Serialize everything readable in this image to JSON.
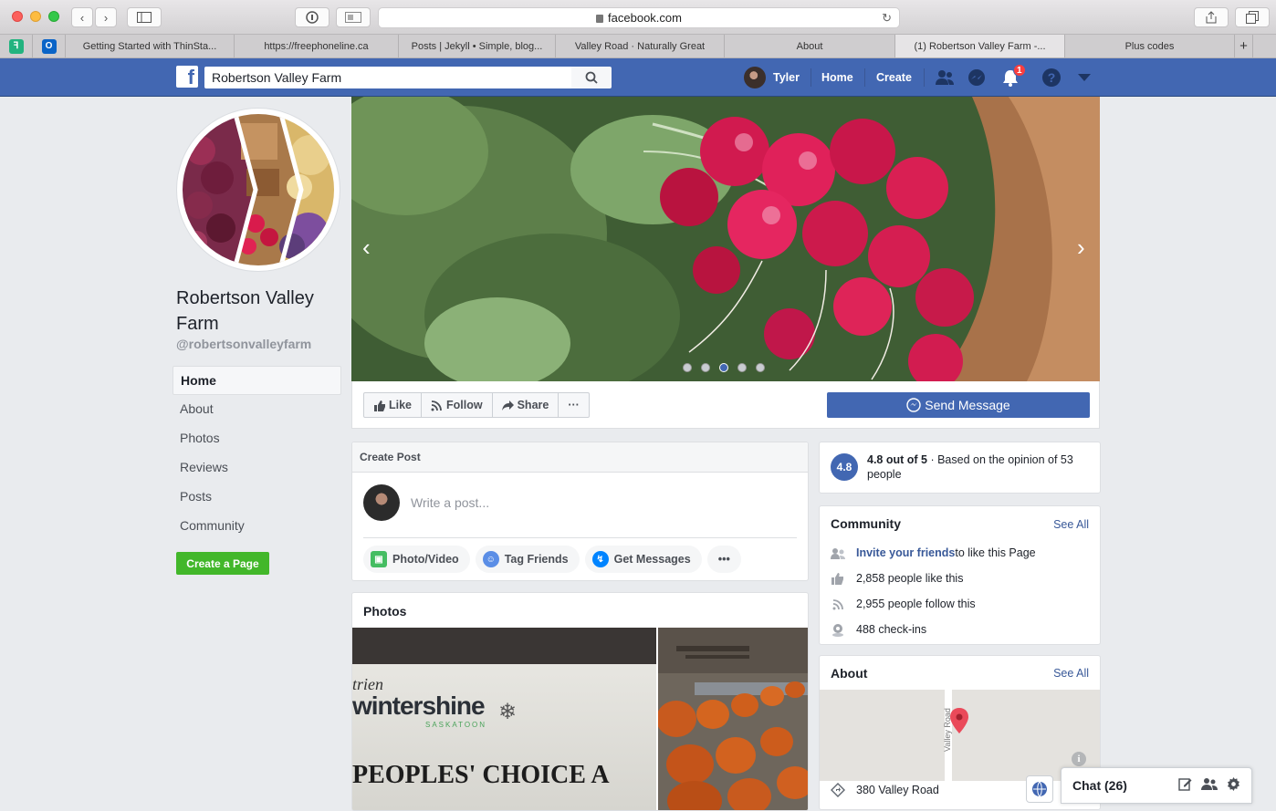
{
  "browser": {
    "url": "facebook.com",
    "tabs": [
      {
        "label": "Getting Started with ThinSta..."
      },
      {
        "label": "https://freephoneline.ca"
      },
      {
        "label": "Posts | Jekyll • Simple, blog..."
      },
      {
        "label": "Valley Road · Naturally Great"
      },
      {
        "label": "About"
      },
      {
        "label": "(1) Robertson Valley Farm -..."
      },
      {
        "label": "Plus codes"
      }
    ],
    "new_tab": "+"
  },
  "fb_header": {
    "search_value": "Robertson Valley Farm",
    "user_name": "Tyler",
    "home": "Home",
    "create": "Create",
    "notification_count": "1"
  },
  "page": {
    "name": "Robertson Valley Farm",
    "handle": "@robertsonvalleyfarm",
    "nav": [
      {
        "label": "Home"
      },
      {
        "label": "About"
      },
      {
        "label": "Photos"
      },
      {
        "label": "Reviews"
      },
      {
        "label": "Posts"
      },
      {
        "label": "Community"
      }
    ],
    "create_page": "Create a Page"
  },
  "cover": {
    "active_slide": 3,
    "slide_count": 5
  },
  "actions": {
    "like": "Like",
    "follow": "Follow",
    "share": "Share",
    "more": "···",
    "send_message": "Send Message"
  },
  "create_post": {
    "title": "Create Post",
    "placeholder": "Write a post...",
    "photo_video": "Photo/Video",
    "tag_friends": "Tag Friends",
    "get_messages": "Get Messages",
    "more": "•••"
  },
  "photos": {
    "title": "Photos",
    "sign_line1": "trien",
    "sign_line2": "wintershine",
    "sign_line3": "SASKATOON",
    "sign_line4": "PEOPLES' CHOICE A"
  },
  "rating": {
    "score": "4.8",
    "headline": "4.8 out of 5",
    "text": " · Based on the opinion of 53 people"
  },
  "community": {
    "title": "Community",
    "see_all": "See All",
    "invite_link": "Invite your friends",
    "invite_rest": " to like this Page",
    "likes": "2,858 people like this",
    "follows": "2,955 people follow this",
    "checkins": "488 check-ins"
  },
  "about": {
    "title": "About",
    "see_all": "See All",
    "road_label": "Valley Road",
    "address": "380 Valley Road"
  },
  "chat": {
    "label": "Chat (26)"
  }
}
